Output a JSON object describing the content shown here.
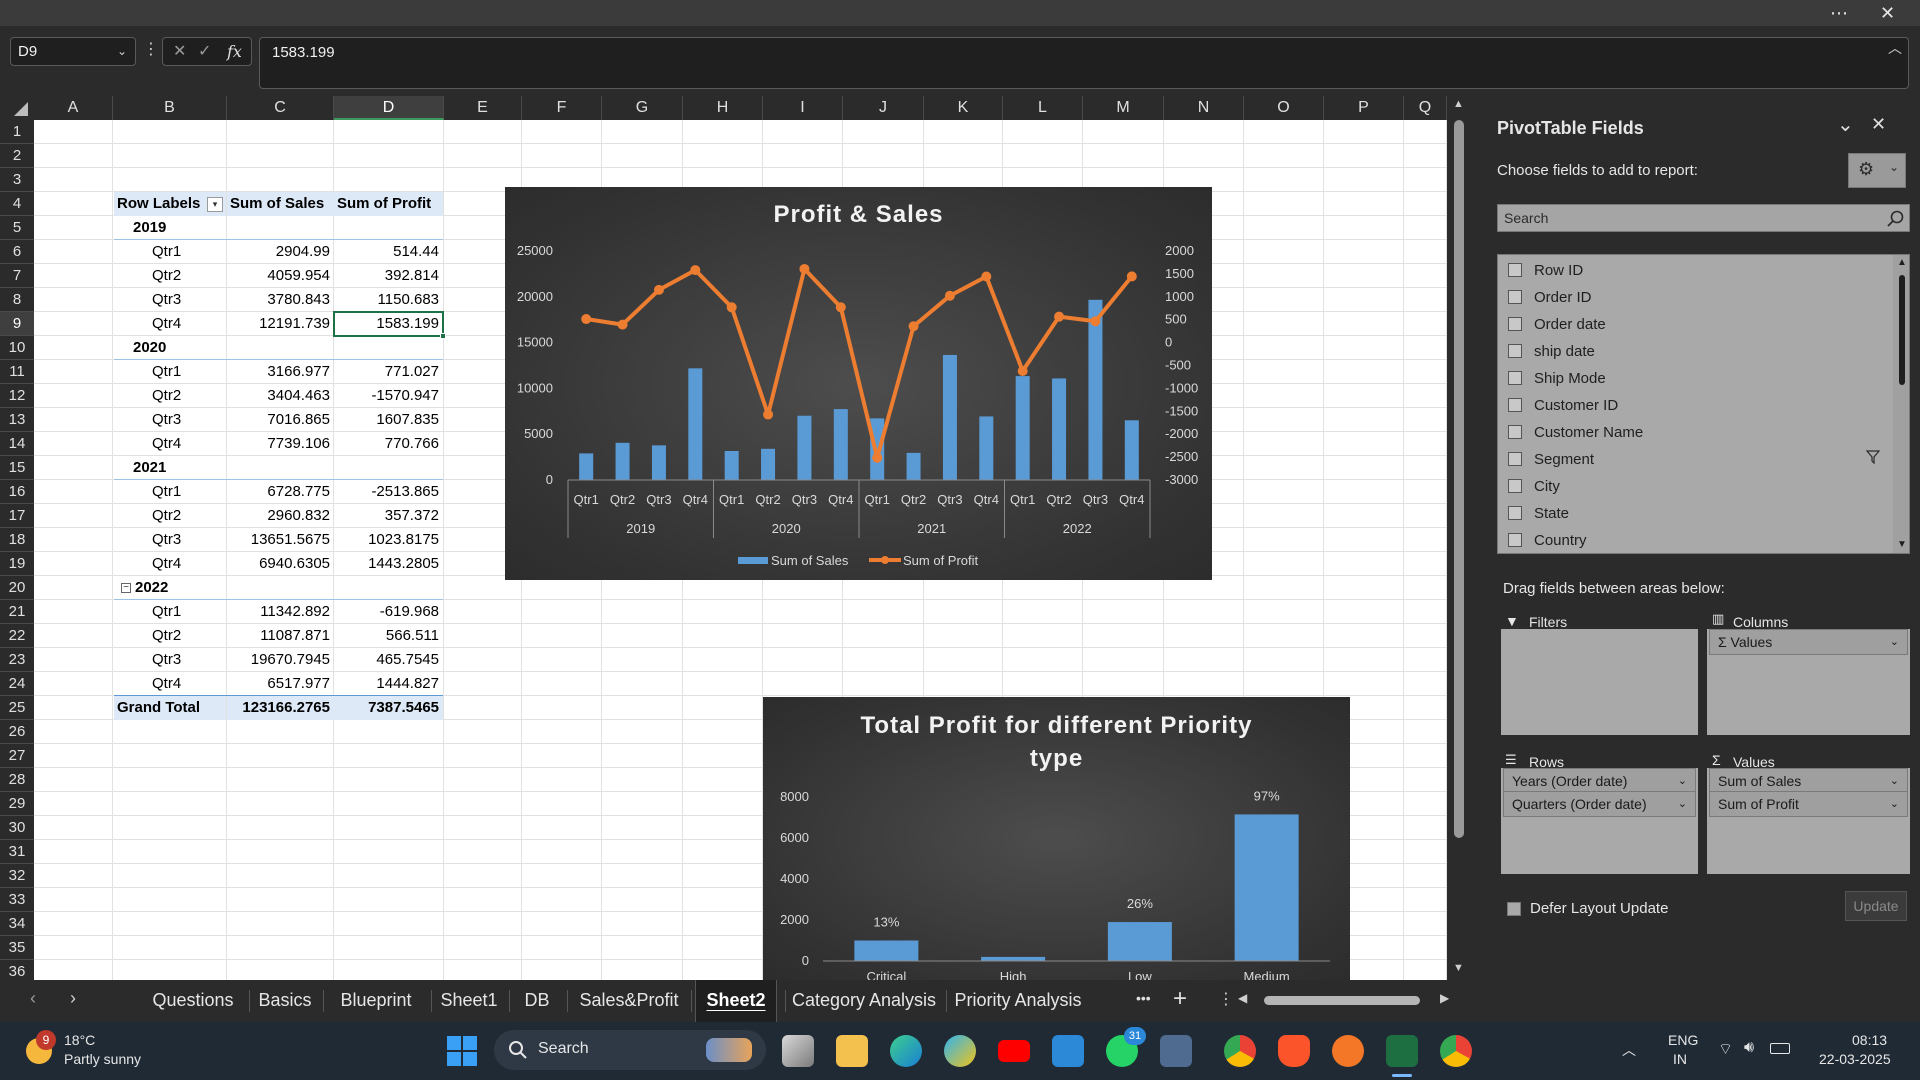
{
  "window": {
    "more_icon": "more-icon",
    "close_icon": "close-icon"
  },
  "formula_bar": {
    "name_box": "D9",
    "formula": "1583.199",
    "fx_label": "fx"
  },
  "grid": {
    "columns": [
      "A",
      "B",
      "C",
      "D",
      "E",
      "F",
      "G",
      "H",
      "I",
      "J",
      "K",
      "L",
      "M",
      "N",
      "O",
      "P",
      "Q"
    ],
    "rows": [
      "1",
      "2",
      "3",
      "4",
      "5",
      "6",
      "7",
      "8",
      "9",
      "10",
      "11",
      "12",
      "13",
      "14",
      "15",
      "16",
      "17",
      "18",
      "19",
      "20",
      "21",
      "22",
      "23",
      "24",
      "25",
      "26",
      "27",
      "28",
      "29",
      "30",
      "31",
      "32",
      "33",
      "34",
      "35",
      "36"
    ],
    "selected_column": "D",
    "selected_row": "9"
  },
  "pivot_table": {
    "headers": [
      "Row Labels",
      "Sum of Sales",
      "Sum of Profit"
    ],
    "rows": [
      {
        "label": "2019",
        "sales": "",
        "profit": "",
        "type": "year"
      },
      {
        "label": "Qtr1",
        "sales": "2904.99",
        "profit": "514.44",
        "type": "q"
      },
      {
        "label": "Qtr2",
        "sales": "4059.954",
        "profit": "392.814",
        "type": "q"
      },
      {
        "label": "Qtr3",
        "sales": "3780.843",
        "profit": "1150.683",
        "type": "q"
      },
      {
        "label": "Qtr4",
        "sales": "12191.739",
        "profit": "1583.199",
        "type": "q"
      },
      {
        "label": "2020",
        "sales": "",
        "profit": "",
        "type": "year"
      },
      {
        "label": "Qtr1",
        "sales": "3166.977",
        "profit": "771.027",
        "type": "q"
      },
      {
        "label": "Qtr2",
        "sales": "3404.463",
        "profit": "-1570.947",
        "type": "q"
      },
      {
        "label": "Qtr3",
        "sales": "7016.865",
        "profit": "1607.835",
        "type": "q"
      },
      {
        "label": "Qtr4",
        "sales": "7739.106",
        "profit": "770.766",
        "type": "q"
      },
      {
        "label": "2021",
        "sales": "",
        "profit": "",
        "type": "year"
      },
      {
        "label": "Qtr1",
        "sales": "6728.775",
        "profit": "-2513.865",
        "type": "q"
      },
      {
        "label": "Qtr2",
        "sales": "2960.832",
        "profit": "357.372",
        "type": "q"
      },
      {
        "label": "Qtr3",
        "sales": "13651.5675",
        "profit": "1023.8175",
        "type": "q"
      },
      {
        "label": "Qtr4",
        "sales": "6940.6305",
        "profit": "1443.2805",
        "type": "q"
      },
      {
        "label": "2022",
        "sales": "",
        "profit": "",
        "type": "year2"
      },
      {
        "label": "Qtr1",
        "sales": "11342.892",
        "profit": "-619.968",
        "type": "q"
      },
      {
        "label": "Qtr2",
        "sales": "11087.871",
        "profit": "566.511",
        "type": "q"
      },
      {
        "label": "Qtr3",
        "sales": "19670.7945",
        "profit": "465.7545",
        "type": "q"
      },
      {
        "label": "Qtr4",
        "sales": "6517.977",
        "profit": "1444.827",
        "type": "q"
      }
    ],
    "grand_total": {
      "label": "Grand Total",
      "sales": "123166.2765",
      "profit": "7387.5465"
    }
  },
  "chart_data": [
    {
      "type": "bar+line",
      "title": "Profit & Sales",
      "categories": [
        "Qtr1",
        "Qtr2",
        "Qtr3",
        "Qtr4",
        "Qtr1",
        "Qtr2",
        "Qtr3",
        "Qtr4",
        "Qtr1",
        "Qtr2",
        "Qtr3",
        "Qtr4",
        "Qtr1",
        "Qtr2",
        "Qtr3",
        "Qtr4"
      ],
      "groups": [
        "2019",
        "2020",
        "2021",
        "2022"
      ],
      "series": [
        {
          "name": "Sum of Sales",
          "kind": "bar",
          "axis": "left",
          "values": [
            2904.99,
            4059.954,
            3780.843,
            12191.739,
            3166.977,
            3404.463,
            7016.865,
            7739.106,
            6728.775,
            2960.832,
            13651.5675,
            6940.6305,
            11342.892,
            11087.871,
            19670.7945,
            6517.977
          ]
        },
        {
          "name": "Sum of Profit",
          "kind": "line",
          "axis": "right",
          "values": [
            514.44,
            392.814,
            1150.683,
            1583.199,
            771.027,
            -1570.947,
            1607.835,
            770.766,
            -2513.865,
            357.372,
            1023.8175,
            1443.2805,
            -619.968,
            566.511,
            465.7545,
            1444.827
          ]
        }
      ],
      "ylim_left": [
        0,
        25000
      ],
      "yticks_left": [
        "0",
        "5000",
        "10000",
        "15000",
        "20000",
        "25000"
      ],
      "ylim_right": [
        -3000,
        2000
      ],
      "yticks_right": [
        "-3000",
        "-2500",
        "-2000",
        "-1500",
        "-1000",
        "-500",
        "0",
        "500",
        "1000",
        "1500",
        "2000"
      ],
      "legend": "bottom",
      "colors": {
        "bar": "#5b9bd5",
        "line": "#ed7d31"
      }
    },
    {
      "type": "bar",
      "title_lines": [
        "Total Profit for different Priority",
        "type"
      ],
      "categories": [
        "Critical",
        "High",
        "Low",
        "Medium"
      ],
      "values": [
        1000,
        200,
        1900,
        7150
      ],
      "data_labels": [
        "13%",
        "",
        "26%",
        "97%"
      ],
      "ylim": [
        0,
        8000
      ],
      "yticks": [
        "0",
        "2000",
        "4000",
        "6000",
        "8000"
      ],
      "colors": {
        "bar": "#5b9bd5"
      }
    }
  ],
  "sheet_tabs": [
    "Questions",
    "Basics",
    "Blueprint",
    "Sheet1",
    "DB",
    "Sales&Profit",
    "Sheet2",
    "Category Analysis",
    "Priority Analysis"
  ],
  "active_tab": "Sheet2",
  "tab_more": "•••",
  "tab_add": "+",
  "pivot_pane": {
    "title": "PivotTable Fields",
    "choose_label": "Choose fields to add to report:",
    "search_placeholder": "Search",
    "fields": [
      "Row ID",
      "Order ID",
      "Order date",
      "ship date",
      "Ship Mode",
      "Customer ID",
      "Customer Name",
      "Segment",
      "City",
      "State",
      "Country"
    ],
    "drag_label": "Drag fields between areas below:",
    "filters_label": "Filters",
    "columns_label": "Columns",
    "rows_label": "Rows",
    "values_label": "Values",
    "columns_items": [
      "Σ Values"
    ],
    "rows_items": [
      "Years (Order date)",
      "Quarters (Order date)"
    ],
    "values_items": [
      "Sum of Sales",
      "Sum of Profit"
    ],
    "defer_label": "Defer Layout Update",
    "update_label": "Update"
  },
  "taskbar": {
    "weather_temp": "18°C",
    "weather_desc": "Partly sunny",
    "weather_badge": "9",
    "search_label": "Search",
    "whatsapp_badge": "31",
    "lang_line1": "ENG",
    "lang_line2": "IN",
    "time": "08:13",
    "date": "22-03-2025"
  }
}
